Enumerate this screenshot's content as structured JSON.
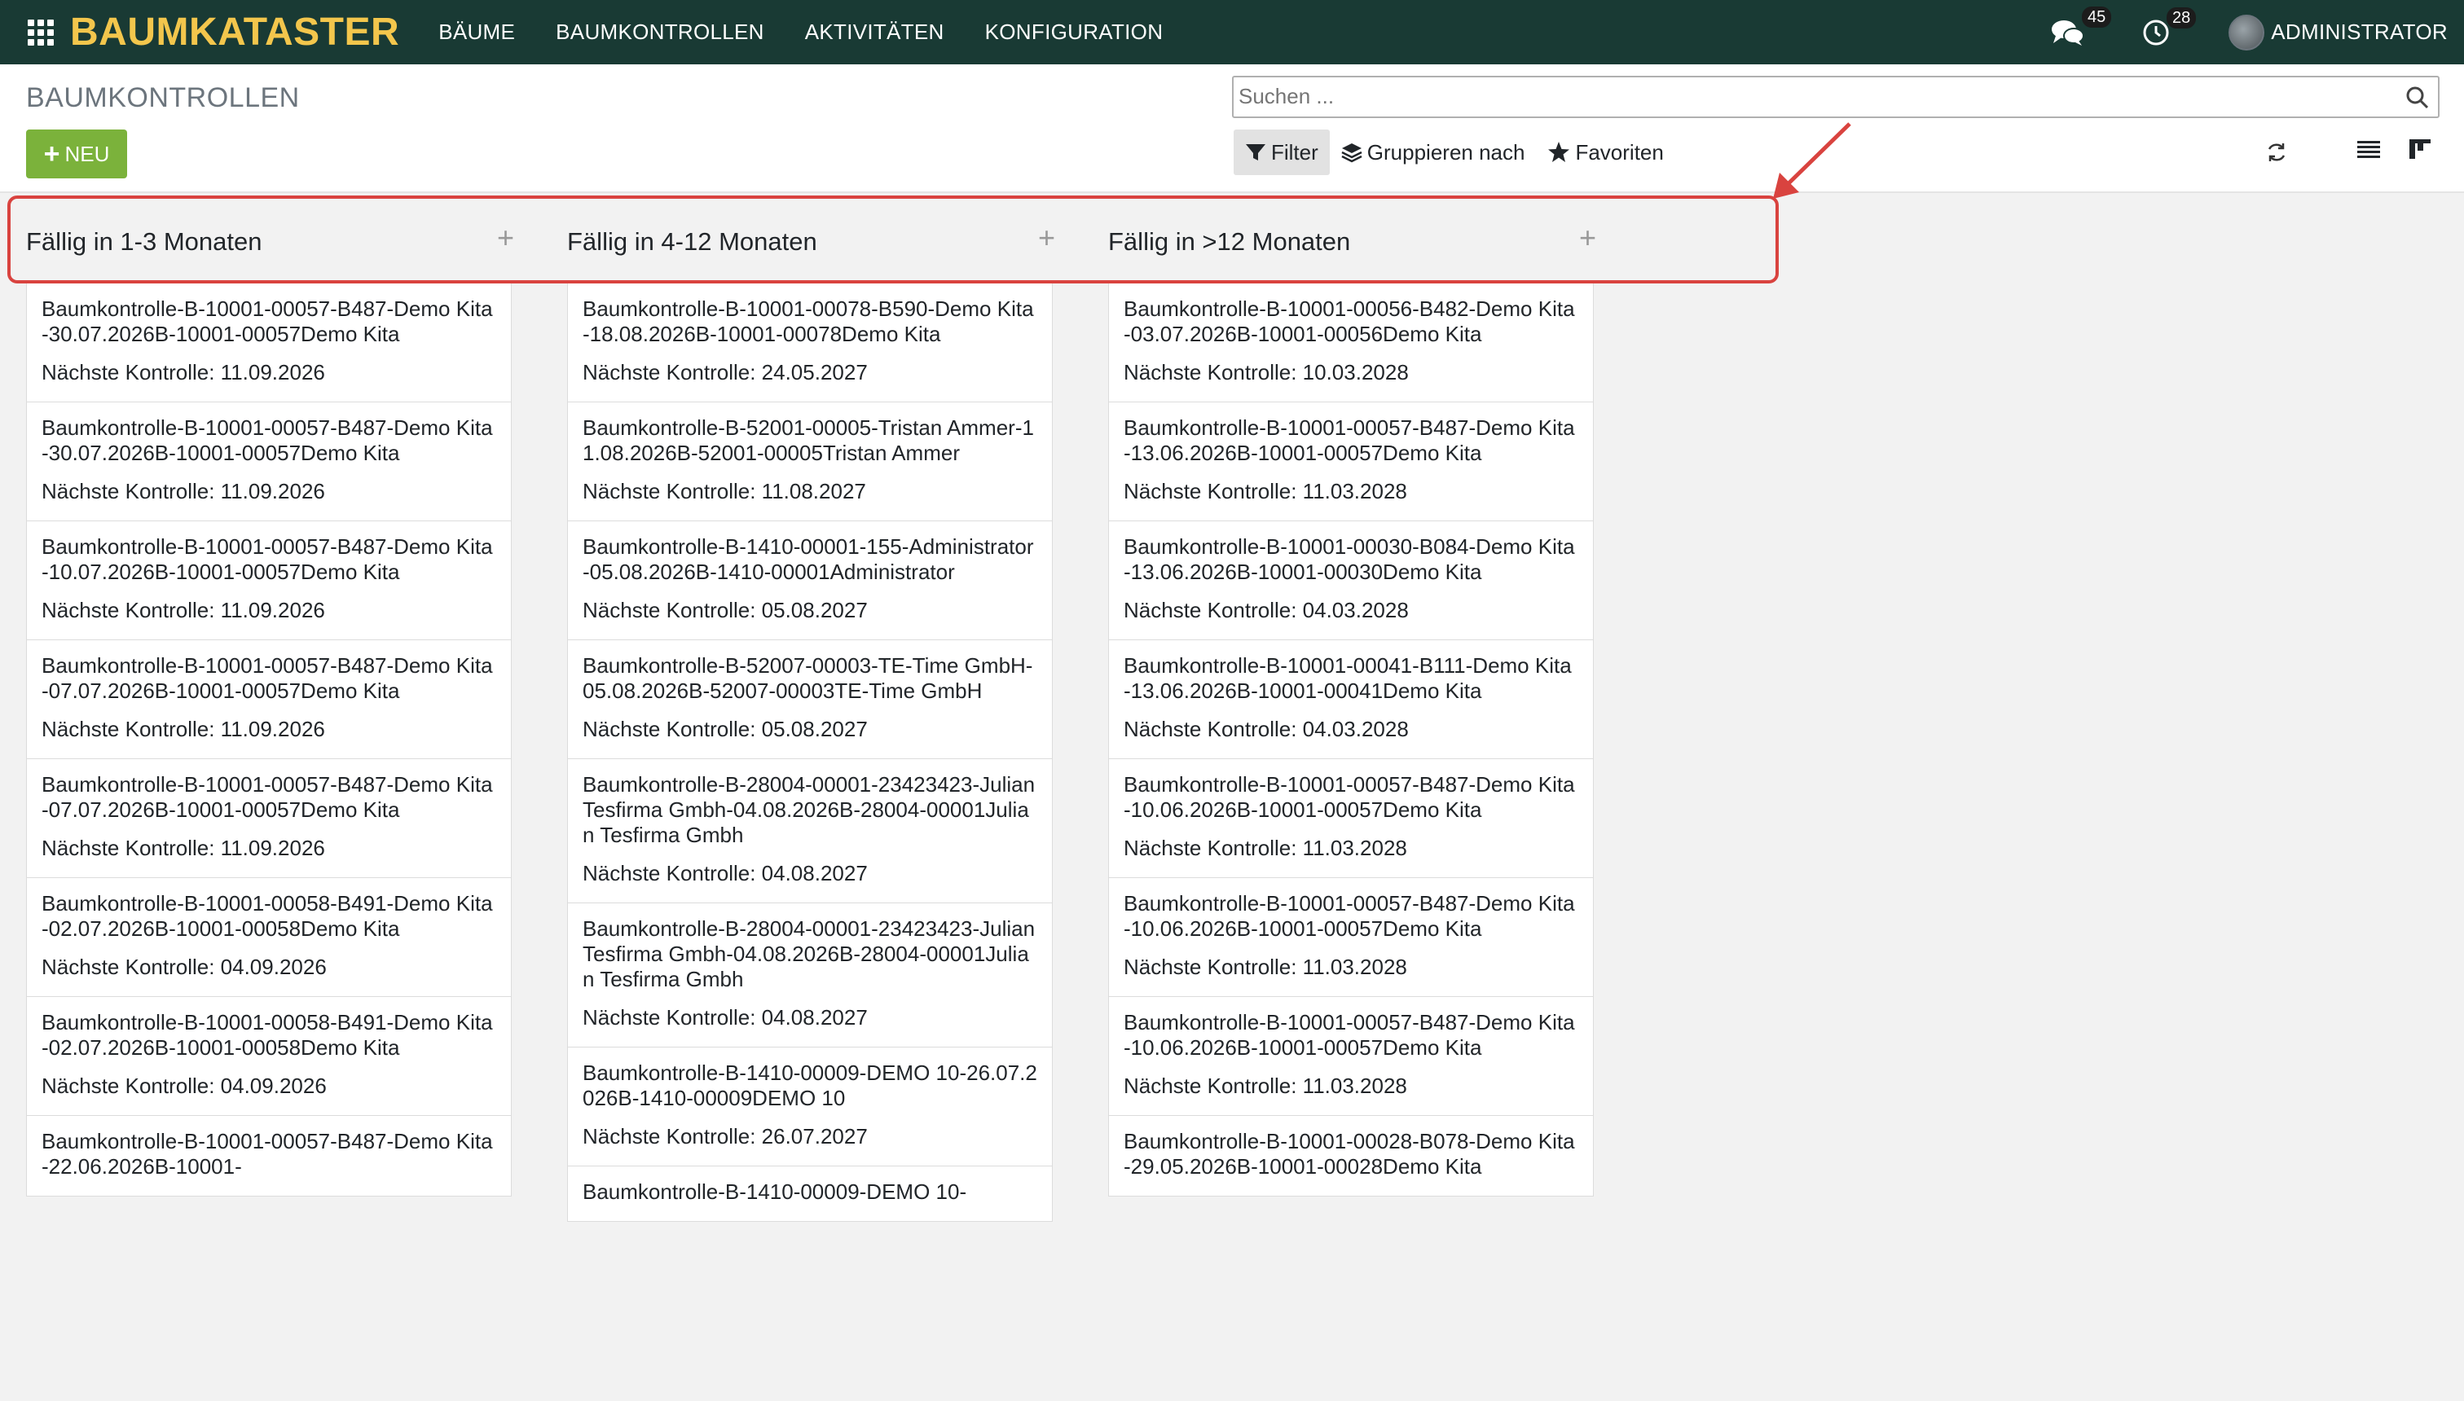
{
  "navbar": {
    "brand": "BAUMKATASTER",
    "menu": [
      "BÄUME",
      "BAUMKONTROLLEN",
      "AKTIVITÄTEN",
      "KONFIGURATION"
    ],
    "messages_count": "45",
    "activities_count": "28",
    "user": "ADMINISTRATOR"
  },
  "control": {
    "title": "BAUMKONTROLLEN",
    "new_label": "NEU",
    "search_placeholder": "Suchen ...",
    "filter_label": "Filter",
    "groupby_label": "Gruppieren nach",
    "favorites_label": "Favoriten"
  },
  "columns": [
    {
      "title": "Fällig in 1-3 Monaten",
      "cards": [
        {
          "name": "Baumkontrolle-B-10001-00057-B487-Demo Kita-30.07.2026B-10001-00057Demo Kita",
          "next": "Nächste Kontrolle: 11.09.2026"
        },
        {
          "name": "Baumkontrolle-B-10001-00057-B487-Demo Kita-30.07.2026B-10001-00057Demo Kita",
          "next": "Nächste Kontrolle: 11.09.2026"
        },
        {
          "name": "Baumkontrolle-B-10001-00057-B487-Demo Kita-10.07.2026B-10001-00057Demo Kita",
          "next": "Nächste Kontrolle: 11.09.2026"
        },
        {
          "name": "Baumkontrolle-B-10001-00057-B487-Demo Kita-07.07.2026B-10001-00057Demo Kita",
          "next": "Nächste Kontrolle: 11.09.2026"
        },
        {
          "name": "Baumkontrolle-B-10001-00057-B487-Demo Kita-07.07.2026B-10001-00057Demo Kita",
          "next": "Nächste Kontrolle: 11.09.2026"
        },
        {
          "name": "Baumkontrolle-B-10001-00058-B491-Demo Kita-02.07.2026B-10001-00058Demo Kita",
          "next": "Nächste Kontrolle: 04.09.2026"
        },
        {
          "name": "Baumkontrolle-B-10001-00058-B491-Demo Kita-02.07.2026B-10001-00058Demo Kita",
          "next": "Nächste Kontrolle: 04.09.2026"
        },
        {
          "name": "Baumkontrolle-B-10001-00057-B487-Demo Kita-22.06.2026B-10001-",
          "next": ""
        }
      ]
    },
    {
      "title": "Fällig in 4-12 Monaten",
      "cards": [
        {
          "name": "Baumkontrolle-B-10001-00078-B590-Demo Kita-18.08.2026B-10001-00078Demo Kita",
          "next": "Nächste Kontrolle: 24.05.2027"
        },
        {
          "name": "Baumkontrolle-B-52001-00005-Tristan Ammer-11.08.2026B-52001-00005Tristan Ammer",
          "next": "Nächste Kontrolle: 11.08.2027"
        },
        {
          "name": "Baumkontrolle-B-1410-00001-155-Administrator-05.08.2026B-1410-00001Administrator",
          "next": "Nächste Kontrolle: 05.08.2027"
        },
        {
          "name": "Baumkontrolle-B-52007-00003-TE-Time GmbH-05.08.2026B-52007-00003TE-Time GmbH",
          "next": "Nächste Kontrolle: 05.08.2027"
        },
        {
          "name": "Baumkontrolle-B-28004-00001-23423423-Julian Tesfirma Gmbh-04.08.2026B-28004-00001Julian Tesfirma Gmbh",
          "next": "Nächste Kontrolle: 04.08.2027"
        },
        {
          "name": "Baumkontrolle-B-28004-00001-23423423-Julian Tesfirma Gmbh-04.08.2026B-28004-00001Julian Tesfirma Gmbh",
          "next": "Nächste Kontrolle: 04.08.2027"
        },
        {
          "name": "Baumkontrolle-B-1410-00009-DEMO 10-26.07.2026B-1410-00009DEMO 10",
          "next": "Nächste Kontrolle: 26.07.2027"
        },
        {
          "name": "Baumkontrolle-B-1410-00009-DEMO 10-",
          "next": ""
        }
      ]
    },
    {
      "title": "Fällig in >12 Monaten",
      "cards": [
        {
          "name": "Baumkontrolle-B-10001-00056-B482-Demo Kita-03.07.2026B-10001-00056Demo Kita",
          "next": "Nächste Kontrolle: 10.03.2028"
        },
        {
          "name": "Baumkontrolle-B-10001-00057-B487-Demo Kita-13.06.2026B-10001-00057Demo Kita",
          "next": "Nächste Kontrolle: 11.03.2028"
        },
        {
          "name": "Baumkontrolle-B-10001-00030-B084-Demo Kita-13.06.2026B-10001-00030Demo Kita",
          "next": "Nächste Kontrolle: 04.03.2028"
        },
        {
          "name": "Baumkontrolle-B-10001-00041-B111-Demo Kita-13.06.2026B-10001-00041Demo Kita",
          "next": "Nächste Kontrolle: 04.03.2028"
        },
        {
          "name": "Baumkontrolle-B-10001-00057-B487-Demo Kita-10.06.2026B-10001-00057Demo Kita",
          "next": "Nächste Kontrolle: 11.03.2028"
        },
        {
          "name": "Baumkontrolle-B-10001-00057-B487-Demo Kita-10.06.2026B-10001-00057Demo Kita",
          "next": "Nächste Kontrolle: 11.03.2028"
        },
        {
          "name": "Baumkontrolle-B-10001-00057-B487-Demo Kita-10.06.2026B-10001-00057Demo Kita",
          "next": "Nächste Kontrolle: 11.03.2028"
        },
        {
          "name": "Baumkontrolle-B-10001-00028-B078-Demo Kita-29.05.2026B-10001-00028Demo Kita",
          "next": ""
        }
      ]
    }
  ],
  "colors": {
    "navbar_bg": "#193a34",
    "brand": "#f3c64c",
    "new_button": "#7bb23b",
    "highlight": "#d9433f"
  }
}
